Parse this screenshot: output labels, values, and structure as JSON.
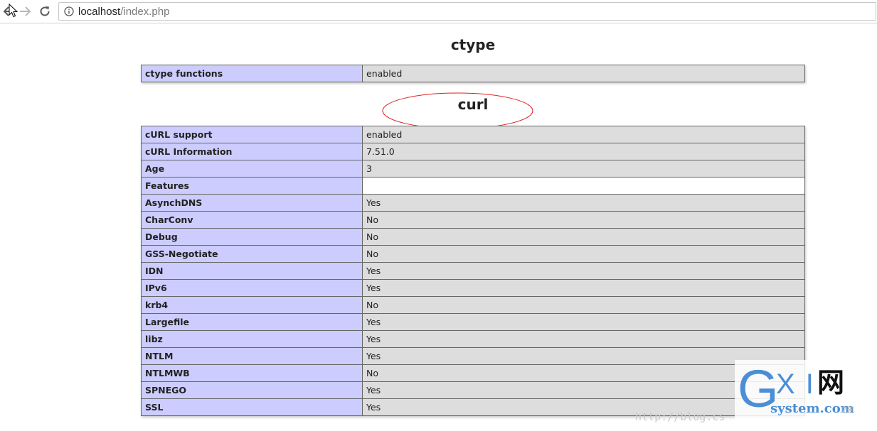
{
  "browser": {
    "url_host": "localhost",
    "url_path": "/index.php",
    "icons": {
      "back": "arrow-left-icon",
      "forward": "arrow-right-icon",
      "reload": "reload-icon",
      "info": "info-icon"
    }
  },
  "ctype": {
    "title": "ctype",
    "rows": [
      {
        "key": "ctype functions",
        "value": "enabled"
      }
    ]
  },
  "curl": {
    "title": "curl",
    "rows": [
      {
        "key": "cURL support",
        "value": "enabled"
      },
      {
        "key": "cURL Information",
        "value": "7.51.0"
      },
      {
        "key": "Age",
        "value": "3"
      },
      {
        "key": "Features",
        "value": ""
      },
      {
        "key": "AsynchDNS",
        "value": "Yes"
      },
      {
        "key": "CharConv",
        "value": "No"
      },
      {
        "key": "Debug",
        "value": "No"
      },
      {
        "key": "GSS-Negotiate",
        "value": "No"
      },
      {
        "key": "IDN",
        "value": "Yes"
      },
      {
        "key": "IPv6",
        "value": "Yes"
      },
      {
        "key": "krb4",
        "value": "No"
      },
      {
        "key": "Largefile",
        "value": "Yes"
      },
      {
        "key": "libz",
        "value": "Yes"
      },
      {
        "key": "NTLM",
        "value": "Yes"
      },
      {
        "key": "NTLMWB",
        "value": "No"
      },
      {
        "key": "SPNEGO",
        "value": "Yes"
      },
      {
        "key": "SSL",
        "value": "Yes"
      }
    ]
  },
  "colors": {
    "key_cell": "#ccccff",
    "value_cell": "#dddddd",
    "annotation": "#e02020"
  },
  "watermark": {
    "url": "http://blog.cs",
    "logo_g": "G",
    "logo_xi": "X I",
    "logo_wang": "网",
    "logo_system": "system.com",
    "logo_sub": "文网"
  }
}
